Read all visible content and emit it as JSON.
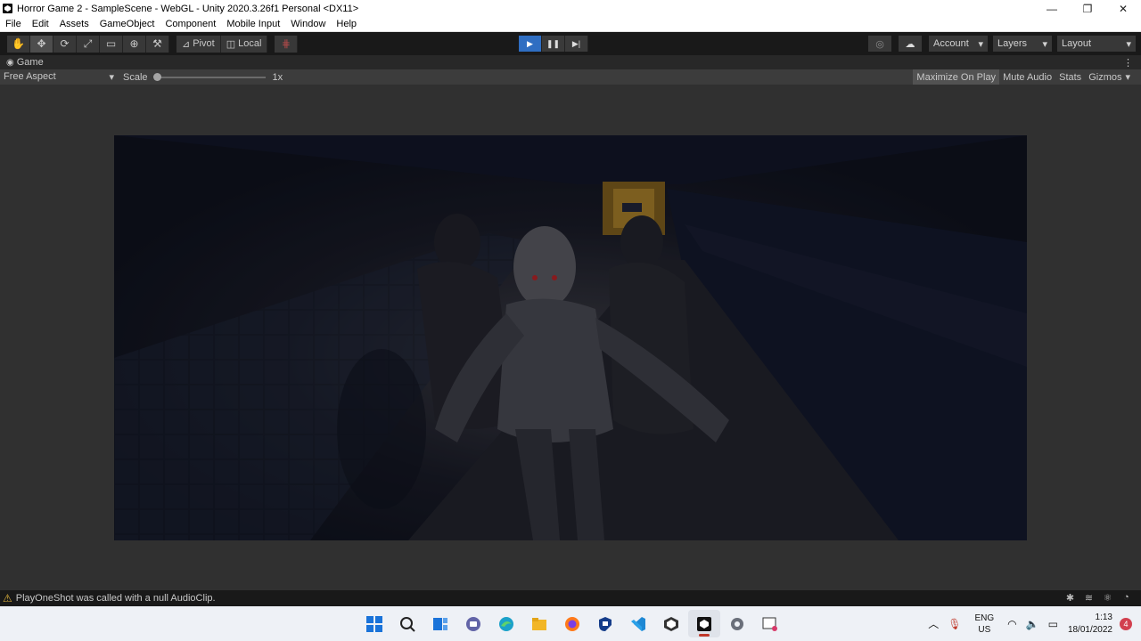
{
  "window": {
    "title": "Horror Game 2 - SampleScene - WebGL - Unity 2020.3.26f1 Personal <DX11>",
    "controls": [
      "—",
      "❐",
      "✕"
    ]
  },
  "menu": [
    "File",
    "Edit",
    "Assets",
    "GameObject",
    "Component",
    "Mobile Input",
    "Window",
    "Help"
  ],
  "toolbar": {
    "pivot": "Pivot",
    "local": "Local",
    "account": "Account",
    "layers": "Layers",
    "layout": "Layout"
  },
  "tab": {
    "label": "Game"
  },
  "game_toolbar": {
    "aspect": "Free Aspect",
    "scale_label": "Scale",
    "scale_value": "1x",
    "maximize": "Maximize On Play",
    "mute": "Mute Audio",
    "stats": "Stats",
    "gizmos": "Gizmos"
  },
  "status": {
    "message": "PlayOneShot was called with a null AudioClip."
  },
  "taskbar": {
    "lang_top": "ENG",
    "lang_bottom": "US",
    "time": "1:13",
    "date": "18/01/2022",
    "notifications": "4"
  },
  "colors": {
    "play_active": "#2f6ec2",
    "warning": "#e0b43c",
    "scene_bg": "#0d1018"
  }
}
